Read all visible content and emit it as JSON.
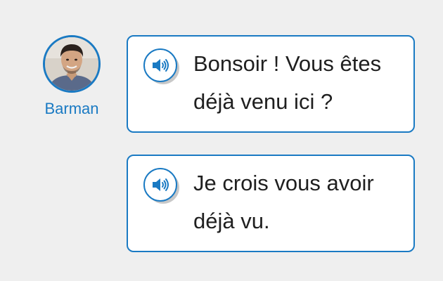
{
  "speaker": {
    "name": "Barman",
    "avatar_icon": "man-portrait-photo"
  },
  "messages": [
    {
      "audio_icon": "speaker-audio-icon",
      "text": "Bonsoir ! Vous êtes déjà venu ici ?"
    },
    {
      "audio_icon": "speaker-audio-icon",
      "text": "Je crois vous avoir déjà vu."
    }
  ],
  "colors": {
    "accent": "#1a7ac3",
    "background": "#efefef",
    "bubble": "#ffffff",
    "text": "#1f1f1f"
  }
}
